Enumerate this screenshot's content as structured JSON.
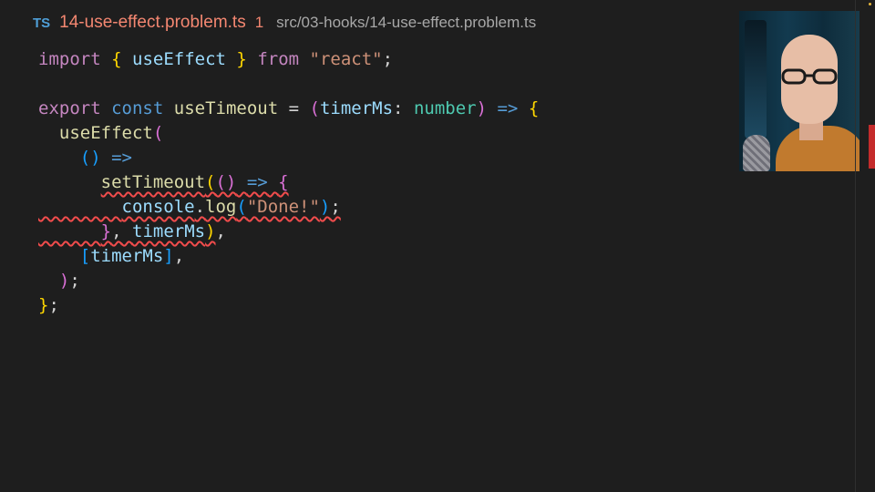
{
  "tab": {
    "language_badge": "TS",
    "file_name": "14-use-effect.problem.ts",
    "error_count": "1",
    "file_path": "src/03-hooks/14-use-effect.problem.ts"
  },
  "code": {
    "l1": {
      "kw": "import",
      "b_open": "{",
      "name": "useEffect",
      "b_close": "}",
      "from": "from",
      "module": "\"react\"",
      "semi": ";"
    },
    "l3": {
      "export": "export",
      "const": "const",
      "name": "useTimeout",
      "eq": "=",
      "p_open": "(",
      "param": "timerMs",
      "colon": ":",
      "type": "number",
      "p_close": ")",
      "arrow": "=>",
      "brace": "{"
    },
    "l4": {
      "fn": "useEffect",
      "p_open": "("
    },
    "l5": {
      "parens": "()",
      "arrow": "=>"
    },
    "l6": {
      "fn": "setTimeout",
      "p_open": "(",
      "parens": "()",
      "arrow": "=>",
      "brace": "{"
    },
    "l7": {
      "obj": "console",
      "dot": ".",
      "method": "log",
      "p_open": "(",
      "str": "\"Done!\"",
      "p_close": ")",
      "semi": ";"
    },
    "l8": {
      "brace": "}",
      "comma": ",",
      "arg": "timerMs",
      "p_close": ")",
      "comma2": ","
    },
    "l9": {
      "b_open": "[",
      "dep": "timerMs",
      "b_close": "]",
      "comma": ","
    },
    "l10": {
      "p_close": ")",
      "semi": ";"
    },
    "l11": {
      "brace": "}",
      "semi": ";"
    }
  },
  "colors": {
    "background": "#1e1e1e",
    "file_name_error": "#f48771",
    "squiggle": "#f14c4c",
    "ts_badge": "#4f9fd8"
  },
  "icons": {
    "ts_badge": "typescript-file-icon"
  }
}
